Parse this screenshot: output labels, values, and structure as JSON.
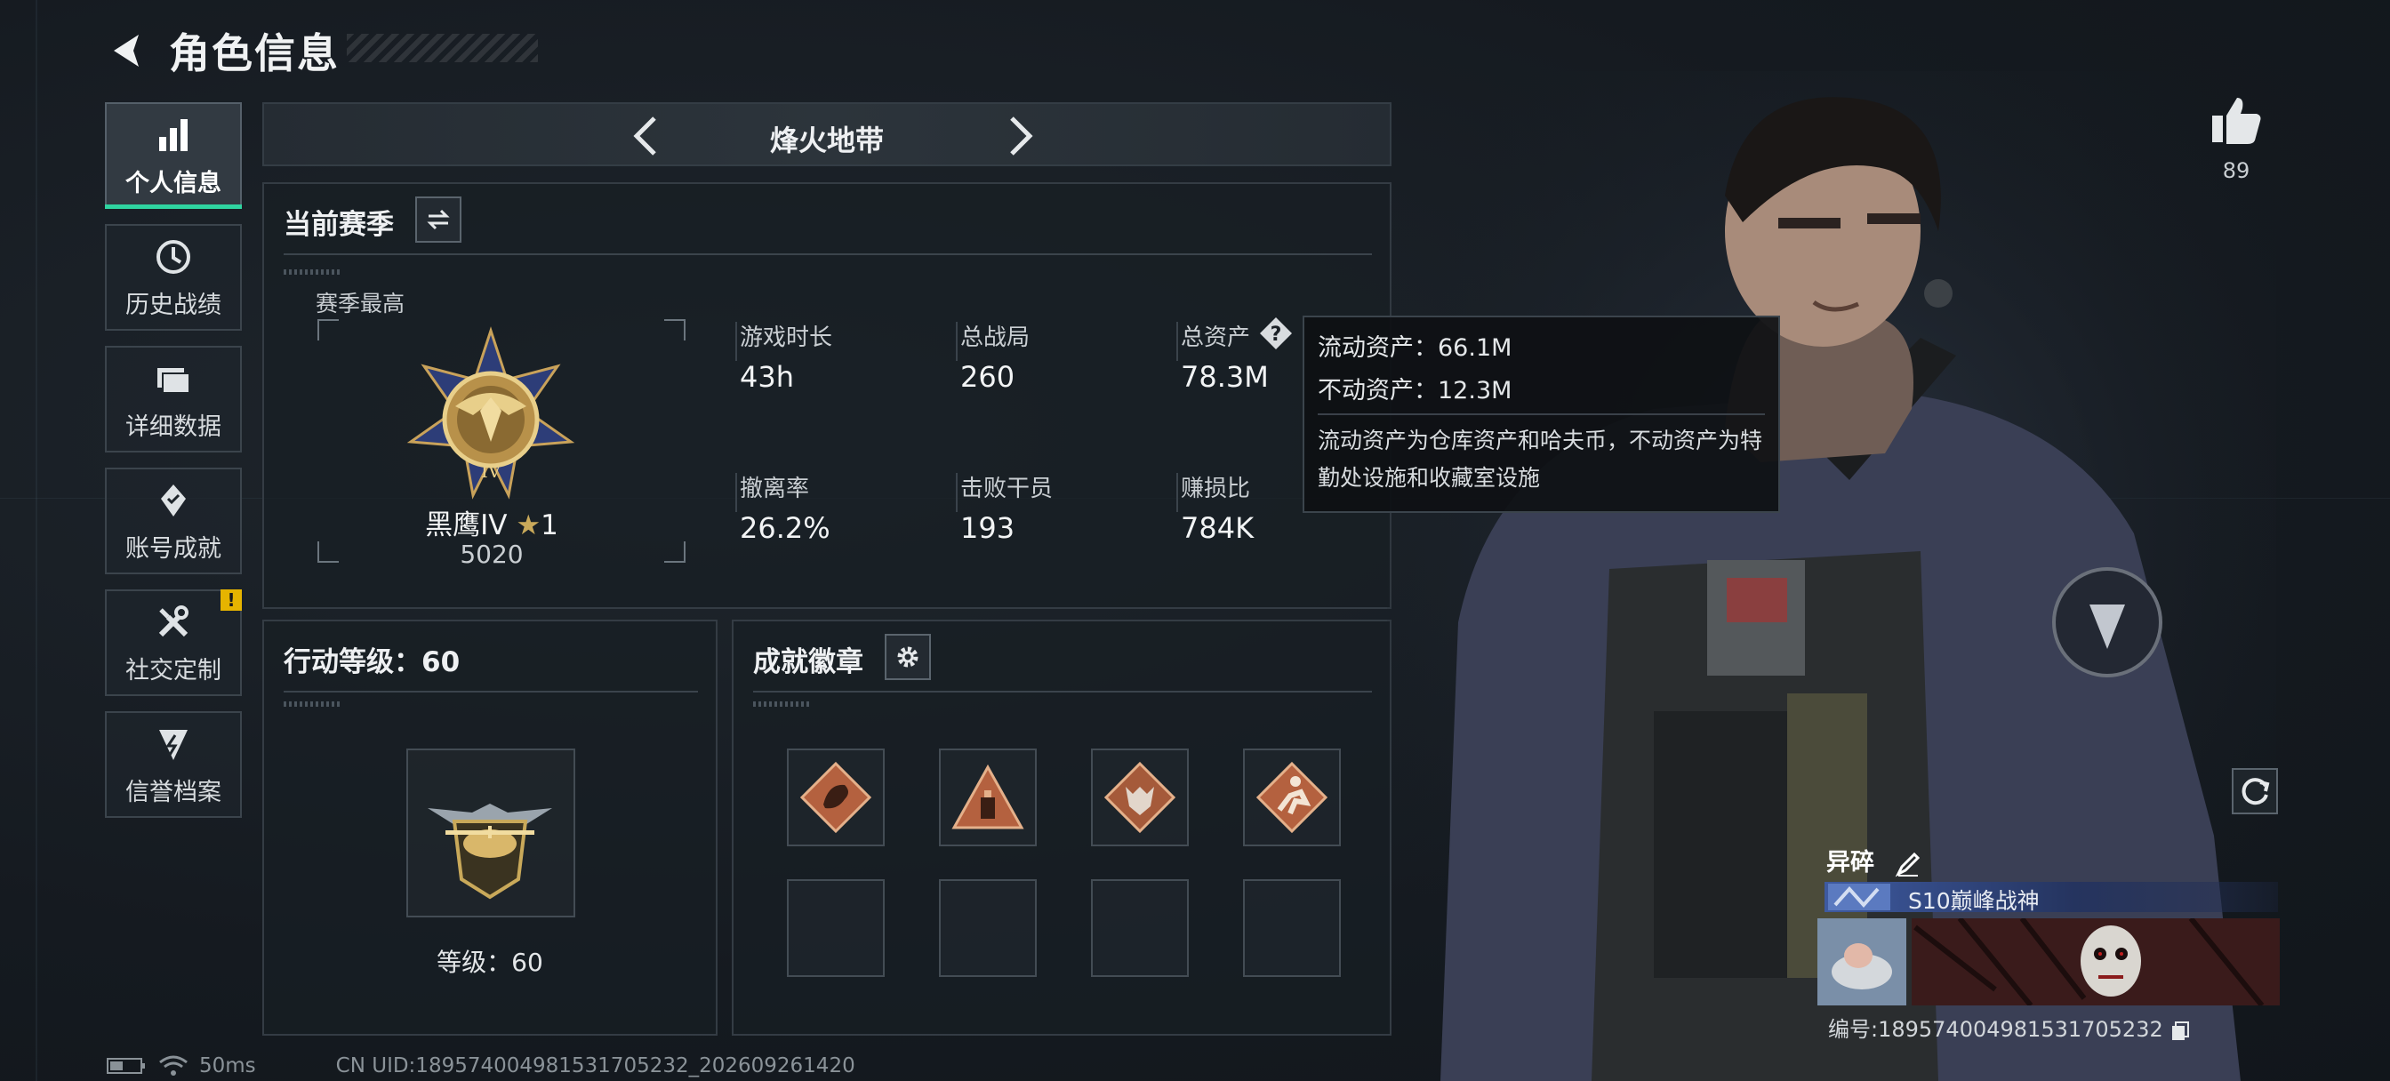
{
  "header": {
    "title": "角色信息"
  },
  "sidebar": {
    "items": [
      {
        "label": "个人信息",
        "icon": "bar-chart-icon",
        "active": true
      },
      {
        "label": "历史战绩",
        "icon": "history-icon"
      },
      {
        "label": "详细数据",
        "icon": "folder-icon"
      },
      {
        "label": "账号成就",
        "icon": "achievement-icon"
      },
      {
        "label": "社交定制",
        "icon": "tools-icon",
        "alert": "!"
      },
      {
        "label": "信誉档案",
        "icon": "credit-icon"
      }
    ]
  },
  "map_selector": {
    "name": "烽火地带"
  },
  "season": {
    "title": "当前赛季",
    "best_label": "赛季最高",
    "rank_name": "黑鹰IV",
    "rank_stars": "1",
    "rank_score": "5020",
    "stats": [
      {
        "label": "游戏时长",
        "value": "43h"
      },
      {
        "label": "总战局",
        "value": "260"
      },
      {
        "label": "总资产",
        "value": "78.3M"
      },
      {
        "label": "撤离率",
        "value": "26.2%"
      },
      {
        "label": "击败干员",
        "value": "193"
      },
      {
        "label": "赚损比",
        "value": "784K"
      }
    ]
  },
  "tooltip": {
    "liquid": "流动资产：66.1M",
    "fixed": "不动资产：12.3M",
    "desc": "流动资产为仓库资产和哈夫币，不动资产为特勤处设施和收藏室设施"
  },
  "level": {
    "title": "行动等级：60",
    "label": "等级：60"
  },
  "badges": {
    "title": "成就徽章"
  },
  "profile": {
    "likes": "89",
    "card_name": "异碎",
    "card_title": "S10巅峰战神",
    "card_id": "编号:189574004981531705232"
  },
  "footer": {
    "ping": "50ms",
    "uid": "CN UID:189574004981531705232_202609261420"
  },
  "colors": {
    "accent": "#2fd4a0",
    "alert": "#e6b400",
    "badge_bronze": "#b4613f"
  }
}
